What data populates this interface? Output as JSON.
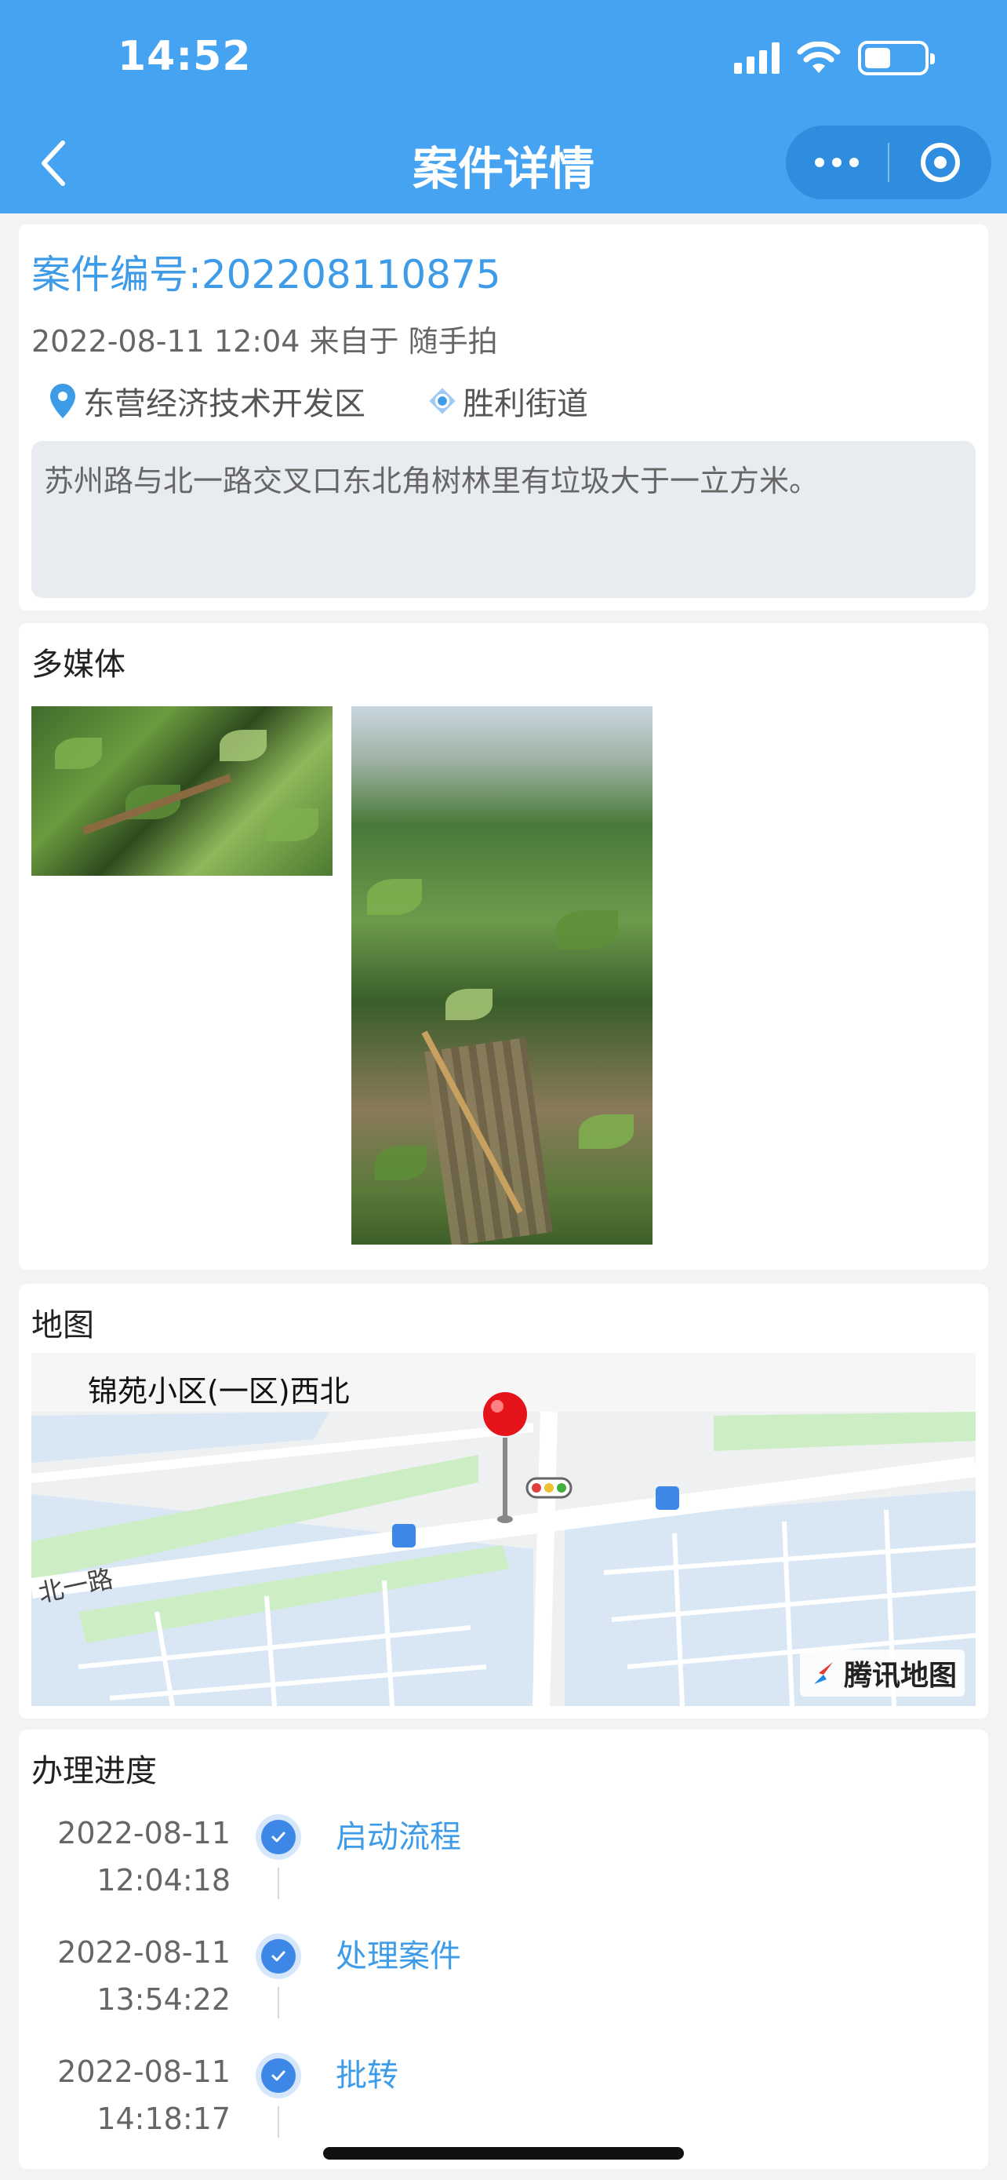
{
  "status_bar": {
    "time": "14:52"
  },
  "nav": {
    "title": "案件详情"
  },
  "case": {
    "number_label": "案件编号:202208110875",
    "meta": "2022-08-11 12:04 来自于 随手拍",
    "district": "东营经济技术开发区",
    "street": "胜利街道",
    "description": "苏州路与北一路交叉口东北角树林里有垃圾大于一立方米。"
  },
  "media": {
    "title": "多媒体"
  },
  "map": {
    "title": "地图",
    "place_label": "锦苑小区(一区)西北",
    "road_label": "北一路",
    "brand": "腾讯地图"
  },
  "progress": {
    "title": "办理进度",
    "steps": [
      {
        "date": "2022-08-11",
        "time": "12:04:18",
        "name": "启动流程"
      },
      {
        "date": "2022-08-11",
        "time": "13:54:22",
        "name": "处理案件"
      },
      {
        "date": "2022-08-11",
        "time": "14:18:17",
        "name": "批转"
      }
    ]
  },
  "colors": {
    "primary": "#45a3f2",
    "link": "#3d9be8",
    "check": "#3d87e6"
  }
}
